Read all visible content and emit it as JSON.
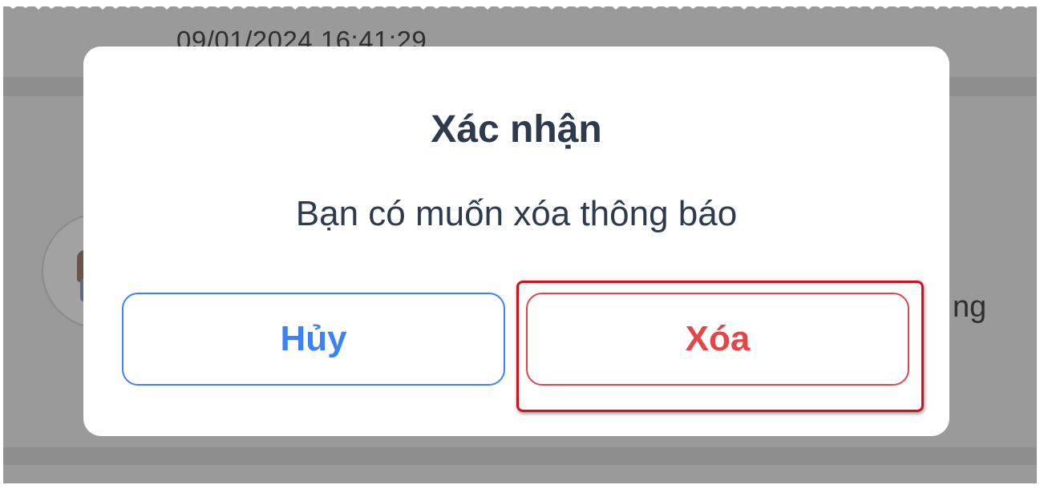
{
  "background": {
    "timestamp": "09/01/2024 16:41:29",
    "peek_text": "ng"
  },
  "dialog": {
    "title": "Xác nhận",
    "message": "Bạn có muốn xóa thông báo",
    "cancel_label": "Hủy",
    "delete_label": "Xóa"
  },
  "colors": {
    "overlay": "#9a9a9a",
    "text": "#2e3a4d",
    "cancel_accent": "#3b82f6",
    "delete_accent": "#e24646",
    "highlight": "#d3101e"
  },
  "icons": {
    "avatar": "user-avatar-icon"
  }
}
